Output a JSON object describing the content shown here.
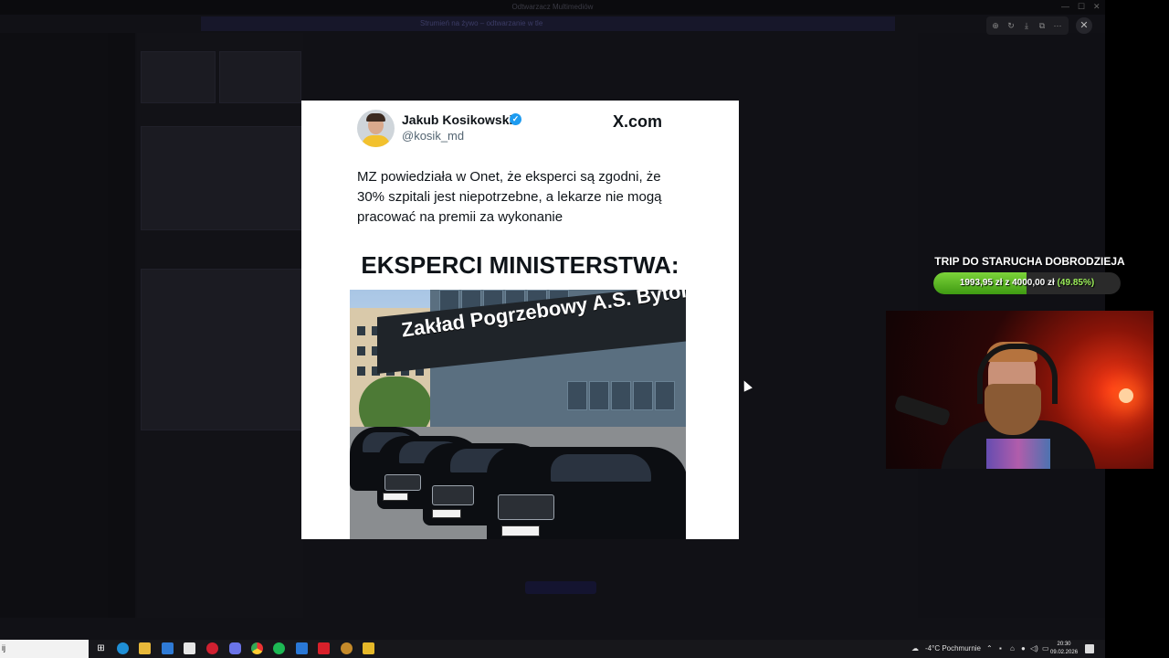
{
  "window": {
    "title": "Odtwarzacz Multimediów",
    "banner": "Strumień na żywo – odtwarzanie w tle"
  },
  "viewer": {
    "toolbar": [
      "zoom-in-icon",
      "rotate-icon",
      "download-icon",
      "open-icon",
      "more-icon"
    ],
    "close_icon": "close-icon"
  },
  "tweet": {
    "author_name": "Jakub Kosikowski",
    "author_handle": "@kosik_md",
    "site": "X.com",
    "text": "MZ powiedziała w Onet, że eksperci są zgodni, że 30% szpitali jest niepotrzebne, a lekarze nie mogą pracować na premii za wykonanie",
    "headline": "EKSPERCI MINISTERSTWA:",
    "image_sign": "Zakład Pogrzebowy A.S. Bytom"
  },
  "donation": {
    "title": "TRIP DO STARUCHA DOBRODZIEJA",
    "current": "1993,95 zł",
    "separator": "z",
    "goal": "4000,00 zł",
    "percent_label": "(49.85%)",
    "progress": 0.4985,
    "bar_color": "#5bbf1f"
  },
  "taskbar": {
    "search_value": "ij",
    "weather": "-4°C  Pochmurnie",
    "time": "20:30",
    "date": "09.02.2026",
    "icons": [
      "start-icon",
      "edge-icon",
      "file-explorer-icon",
      "mail-icon",
      "store-icon",
      "opera-icon",
      "discord-icon",
      "chrome-icon",
      "spotify-icon",
      "media-player-icon",
      "red-app-icon",
      "torch-icon",
      "yellow-app-icon"
    ]
  }
}
